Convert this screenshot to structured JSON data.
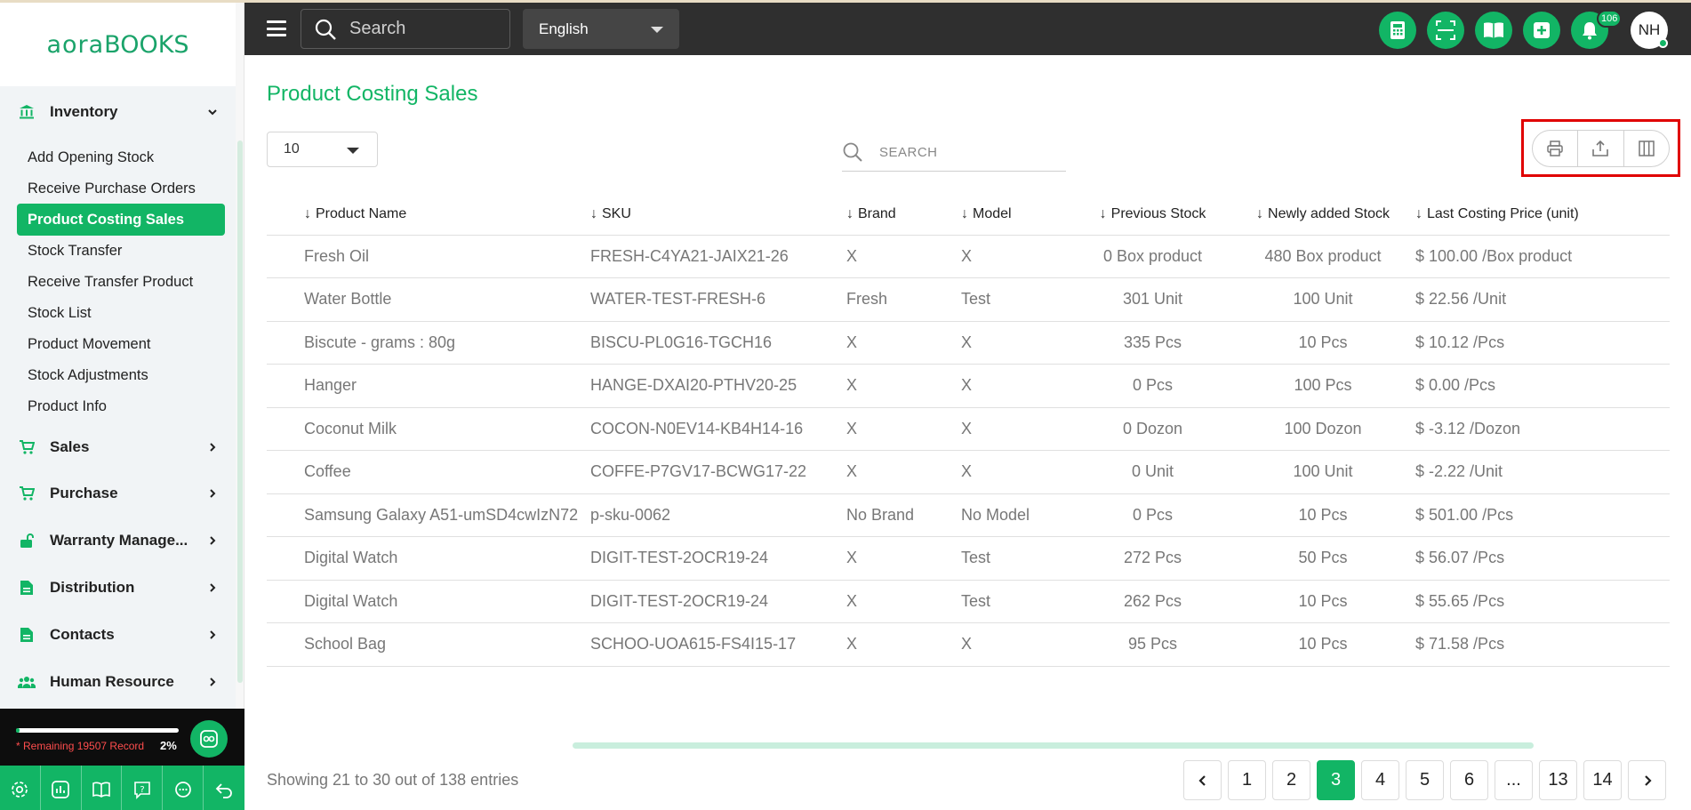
{
  "app": {
    "logo_text": "aora",
    "logo_text_bold": "BOOKS",
    "accent": "#12b565",
    "topbar_color": "#2f2f2f",
    "highlight_color": "#e00000"
  },
  "topbar": {
    "search_placeholder": "Search",
    "language": "English",
    "icons": [
      "calculator-icon",
      "scan-icon",
      "book-icon",
      "add-icon",
      "bell-icon"
    ],
    "notification_count": "106",
    "avatar_initials": "NH"
  },
  "sidebar": {
    "inventory": {
      "label": "Inventory",
      "items": [
        {
          "label": "Add Opening Stock"
        },
        {
          "label": "Receive Purchase Orders"
        },
        {
          "label": "Product Costing Sales"
        },
        {
          "label": "Stock Transfer"
        },
        {
          "label": "Receive Transfer Product"
        },
        {
          "label": "Stock List"
        },
        {
          "label": "Product Movement"
        },
        {
          "label": "Stock Adjustments"
        },
        {
          "label": "Product Info"
        }
      ],
      "active_index": 2
    },
    "sections": [
      {
        "label": "Sales",
        "icon": "cart-icon"
      },
      {
        "label": "Purchase",
        "icon": "cart-icon"
      },
      {
        "label": "Warranty Manage...",
        "icon": "unlock-icon"
      },
      {
        "label": "Distribution",
        "icon": "document-icon"
      },
      {
        "label": "Contacts",
        "icon": "document-icon"
      },
      {
        "label": "Human Resource",
        "icon": "users-icon"
      }
    ],
    "storage": {
      "remaining_text": "* Remaining 19507 Record",
      "percent_text": "2%",
      "percent_value": 2
    },
    "bottom_icons": [
      "settings-icon",
      "chart-icon",
      "book-open-icon",
      "help-icon",
      "chat-icon",
      "logout-icon"
    ]
  },
  "page": {
    "title": "Product Costing Sales",
    "per_page": "10",
    "search_placeholder": "SEARCH",
    "actions": [
      "print-icon",
      "export-icon",
      "columns-icon"
    ]
  },
  "table": {
    "headers": [
      "Product Name",
      "SKU",
      "Brand",
      "Model",
      "Previous Stock",
      "Newly added Stock",
      "Last Costing Price (unit)"
    ],
    "rows": [
      [
        "Fresh Oil",
        "FRESH-C4YA21-JAIX21-26",
        "X",
        "X",
        "0 Box product",
        "480 Box product",
        "$ 100.00 /Box product"
      ],
      [
        "Water Bottle",
        "WATER-TEST-FRESH-6",
        "Fresh",
        "Test",
        "301 Unit",
        "100 Unit",
        "$ 22.56 /Unit"
      ],
      [
        "Biscute - grams : 80g",
        "BISCU-PL0G16-TGCH16",
        "X",
        "X",
        "335 Pcs",
        "10 Pcs",
        "$ 10.12 /Pcs"
      ],
      [
        "Hanger",
        "HANGE-DXAI20-PTHV20-25",
        "X",
        "X",
        "0 Pcs",
        "100 Pcs",
        "$ 0.00 /Pcs"
      ],
      [
        "Coconut Milk",
        "COCON-N0EV14-KB4H14-16",
        "X",
        "X",
        "0 Dozon",
        "100 Dozon",
        "$ -3.12 /Dozon"
      ],
      [
        "Coffee",
        "COFFE-P7GV17-BCWG17-22",
        "X",
        "X",
        "0 Unit",
        "100 Unit",
        "$ -2.22 /Unit"
      ],
      [
        "Samsung Galaxy A51-umSD4cwIzN72",
        "p-sku-0062",
        "No Brand",
        "No Model",
        "0 Pcs",
        "10 Pcs",
        "$ 501.00 /Pcs"
      ],
      [
        "Digital Watch",
        "DIGIT-TEST-2OCR19-24",
        "X",
        "Test",
        "272 Pcs",
        "50 Pcs",
        "$ 56.07 /Pcs"
      ],
      [
        "Digital Watch",
        "DIGIT-TEST-2OCR19-24",
        "X",
        "Test",
        "262 Pcs",
        "10 Pcs",
        "$ 55.65 /Pcs"
      ],
      [
        "School Bag",
        "SCHOO-UOA615-FS4I15-17",
        "X",
        "X",
        "95 Pcs",
        "10 Pcs",
        "$ 71.58 /Pcs"
      ]
    ]
  },
  "footer": {
    "showing": "Showing 21 to 30 out of 138 entries",
    "pages": [
      "1",
      "2",
      "3",
      "4",
      "5",
      "6",
      "...",
      "13",
      "14"
    ],
    "current_page": "3"
  }
}
